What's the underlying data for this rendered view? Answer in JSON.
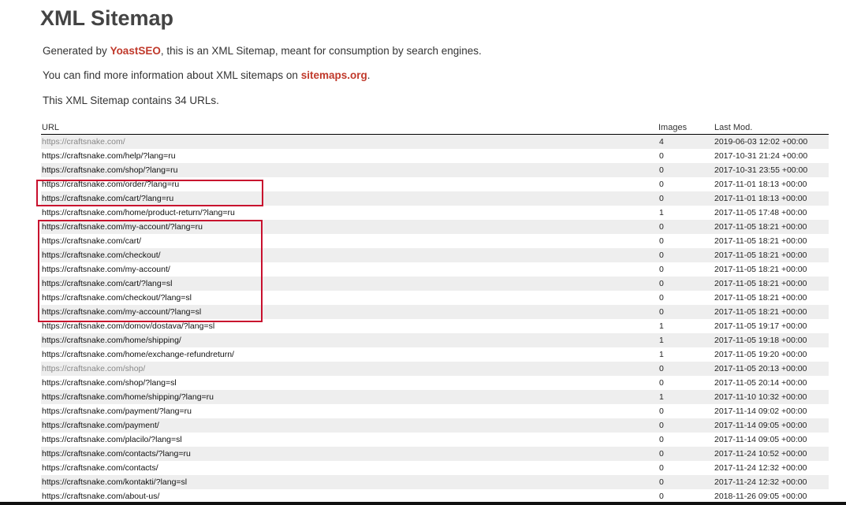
{
  "page": {
    "title": "XML Sitemap",
    "intro1": {
      "before": "Generated by ",
      "link": "YoastSEO",
      "after": ", this is an XML Sitemap, meant for consumption by search engines."
    },
    "intro2": {
      "before": "You can find more information about XML sitemaps on ",
      "link": "sitemaps.org",
      "after": "."
    },
    "intro3": "This XML Sitemap contains 34 URLs.",
    "link_color": "#c0392b",
    "highlight_color": "#c8102e"
  },
  "table": {
    "headers": {
      "url": "URL",
      "images": "Images",
      "lastmod": "Last Mod."
    },
    "rows": [
      {
        "url": "https://craftsnake.com/",
        "images": "4",
        "lastmod": "2019-06-03 12:02 +00:00",
        "faded": true
      },
      {
        "url": "https://craftsnake.com/help/?lang=ru",
        "images": "0",
        "lastmod": "2017-10-31 21:24 +00:00"
      },
      {
        "url": "https://craftsnake.com/shop/?lang=ru",
        "images": "0",
        "lastmod": "2017-10-31 23:55 +00:00"
      },
      {
        "url": "https://craftsnake.com/order/?lang=ru",
        "images": "0",
        "lastmod": "2017-11-01 18:13 +00:00"
      },
      {
        "url": "https://craftsnake.com/cart/?lang=ru",
        "images": "0",
        "lastmod": "2017-11-01 18:13 +00:00"
      },
      {
        "url": "https://craftsnake.com/home/product-return/?lang=ru",
        "images": "1",
        "lastmod": "2017-11-05 17:48 +00:00"
      },
      {
        "url": "https://craftsnake.com/my-account/?lang=ru",
        "images": "0",
        "lastmod": "2017-11-05 18:21 +00:00"
      },
      {
        "url": "https://craftsnake.com/cart/",
        "images": "0",
        "lastmod": "2017-11-05 18:21 +00:00"
      },
      {
        "url": "https://craftsnake.com/checkout/",
        "images": "0",
        "lastmod": "2017-11-05 18:21 +00:00"
      },
      {
        "url": "https://craftsnake.com/my-account/",
        "images": "0",
        "lastmod": "2017-11-05 18:21 +00:00"
      },
      {
        "url": "https://craftsnake.com/cart/?lang=sl",
        "images": "0",
        "lastmod": "2017-11-05 18:21 +00:00"
      },
      {
        "url": "https://craftsnake.com/checkout/?lang=sl",
        "images": "0",
        "lastmod": "2017-11-05 18:21 +00:00"
      },
      {
        "url": "https://craftsnake.com/my-account/?lang=sl",
        "images": "0",
        "lastmod": "2017-11-05 18:21 +00:00"
      },
      {
        "url": "https://craftsnake.com/domov/dostava/?lang=sl",
        "images": "1",
        "lastmod": "2017-11-05 19:17 +00:00"
      },
      {
        "url": "https://craftsnake.com/home/shipping/",
        "images": "1",
        "lastmod": "2017-11-05 19:18 +00:00"
      },
      {
        "url": "https://craftsnake.com/home/exchange-refundreturn/",
        "images": "1",
        "lastmod": "2017-11-05 19:20 +00:00"
      },
      {
        "url": "https://craftsnake.com/shop/",
        "images": "0",
        "lastmod": "2017-11-05 20:13 +00:00",
        "faded": true
      },
      {
        "url": "https://craftsnake.com/shop/?lang=sl",
        "images": "0",
        "lastmod": "2017-11-05 20:14 +00:00"
      },
      {
        "url": "https://craftsnake.com/home/shipping/?lang=ru",
        "images": "1",
        "lastmod": "2017-11-10 10:32 +00:00"
      },
      {
        "url": "https://craftsnake.com/payment/?lang=ru",
        "images": "0",
        "lastmod": "2017-11-14 09:02 +00:00"
      },
      {
        "url": "https://craftsnake.com/payment/",
        "images": "0",
        "lastmod": "2017-11-14 09:05 +00:00"
      },
      {
        "url": "https://craftsnake.com/placilo/?lang=sl",
        "images": "0",
        "lastmod": "2017-11-14 09:05 +00:00"
      },
      {
        "url": "https://craftsnake.com/contacts/?lang=ru",
        "images": "0",
        "lastmod": "2017-11-24 10:52 +00:00"
      },
      {
        "url": "https://craftsnake.com/contacts/",
        "images": "0",
        "lastmod": "2017-11-24 12:32 +00:00"
      },
      {
        "url": "https://craftsnake.com/kontakti/?lang=sl",
        "images": "0",
        "lastmod": "2017-11-24 12:32 +00:00"
      },
      {
        "url": "https://craftsnake.com/about-us/",
        "images": "0",
        "lastmod": "2018-11-26 09:05 +00:00"
      }
    ]
  }
}
